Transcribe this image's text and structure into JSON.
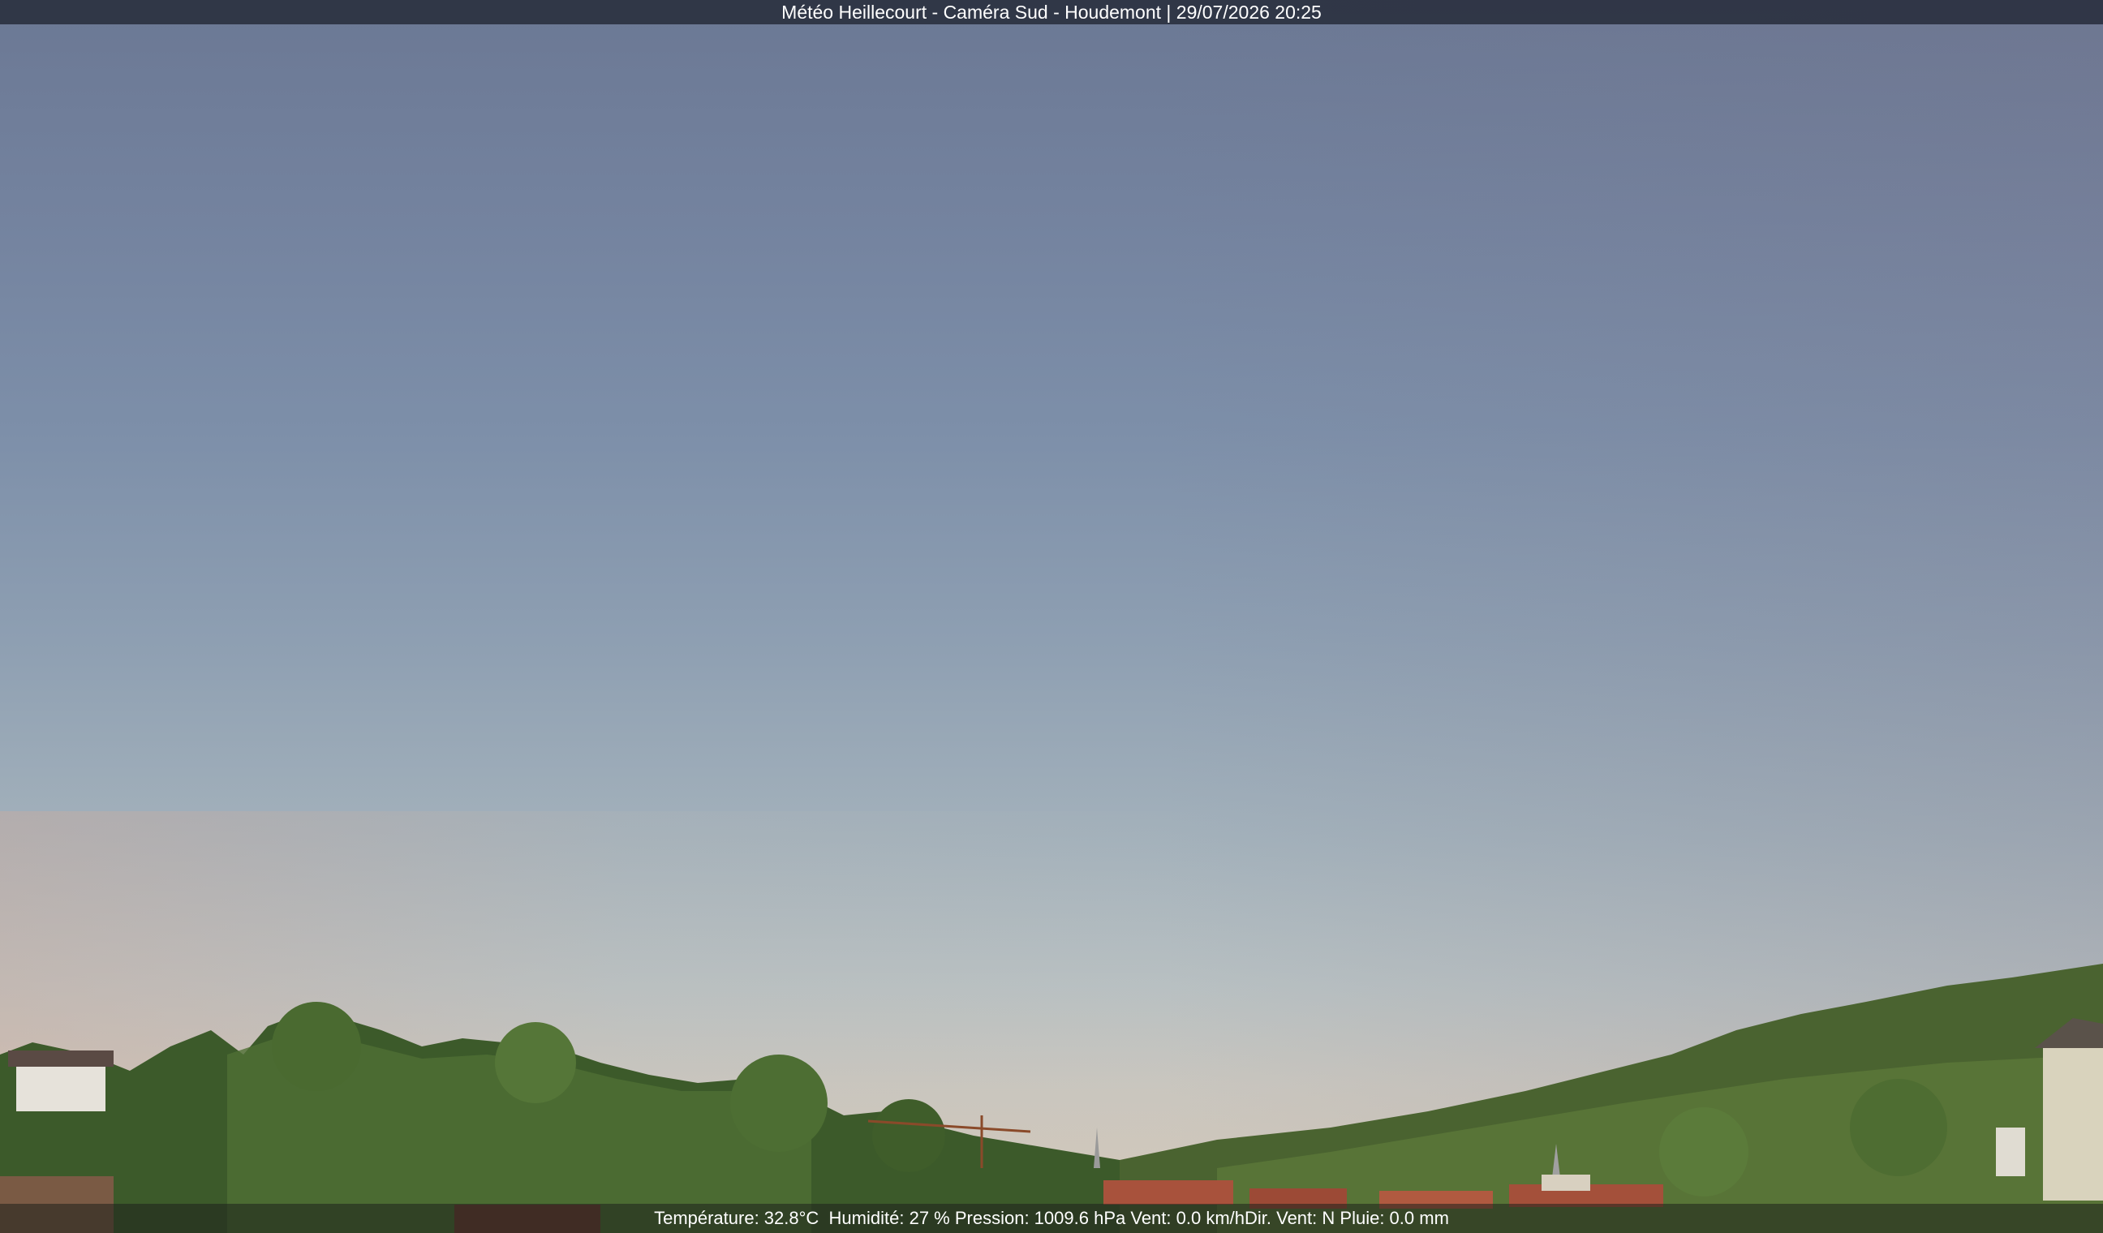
{
  "camera": {
    "title": "Météo Heillecourt - Caméra Sud - Houdemont | 29/07/2026 20:25"
  },
  "weather": {
    "temperature": "Température: 32.8°C",
    "humidity": "Humidité: 27 %",
    "pressure": "Pression: 1009.6 hPa",
    "wind_speed": "Vent: 0.0 km/h",
    "wind_direction": "Dir. Vent: N",
    "rain": "Pluie: 0.0 mm"
  },
  "colors": {
    "sky_top": "#6b7894",
    "sky_horizon": "#d6c9b8",
    "foliage": "#3f5a2c"
  }
}
